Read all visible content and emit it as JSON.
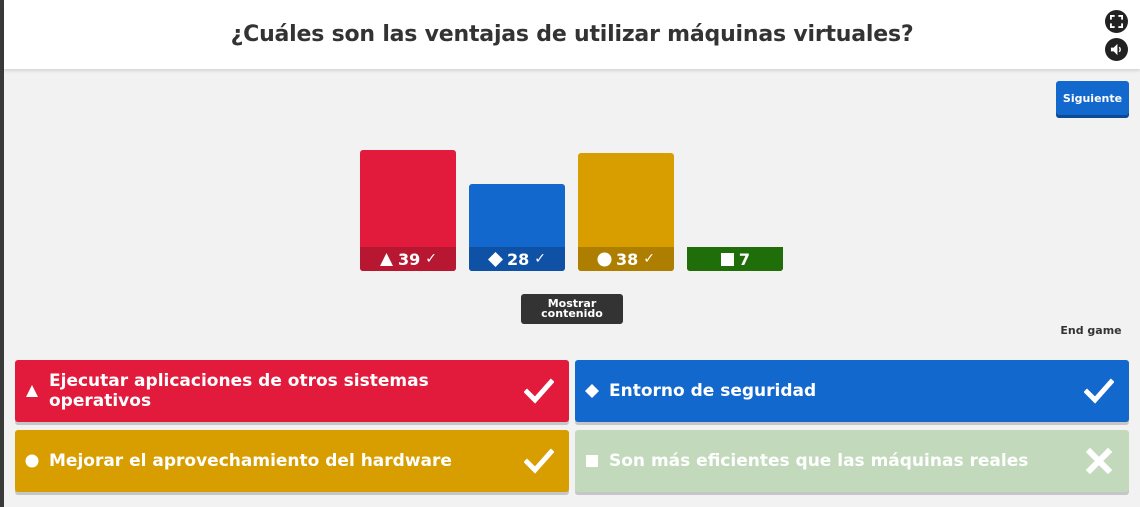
{
  "header": {
    "title": "¿Cuáles son las ventajas de utilizar máquinas virtuales?"
  },
  "controls": {
    "fullscreen_icon": "fullscreen-icon",
    "sound_icon": "speaker-icon",
    "next_label": "Siguiente",
    "show_media_label": "Mostrar contenido",
    "end_game_label": "End game"
  },
  "chart_data": {
    "type": "bar",
    "categories": [
      "triangle",
      "diamond",
      "circle",
      "square"
    ],
    "values": [
      39,
      28,
      38,
      7
    ],
    "correct": [
      true,
      true,
      true,
      false
    ],
    "colors": [
      "#e21b3c",
      "#1368ce",
      "#d89e00",
      "#26890c"
    ],
    "label_colors": [
      "#b71730",
      "#0f52a5",
      "#ad7e00",
      "#1f6e0a"
    ]
  },
  "answers": [
    {
      "shape": "triangle",
      "text": "Ejecutar aplicaciones de otros sistemas operativos",
      "correct": true,
      "color": "#e21b3c"
    },
    {
      "shape": "diamond",
      "text": "Entorno de seguridad",
      "correct": true,
      "color": "#1368ce"
    },
    {
      "shape": "circle",
      "text": "Mejorar el aprovechamiento del hardware",
      "correct": true,
      "color": "#d89e00"
    },
    {
      "shape": "square",
      "text": "Son más eficientes que las máquinas reales",
      "correct": false,
      "color": "#c2d9bc"
    }
  ]
}
